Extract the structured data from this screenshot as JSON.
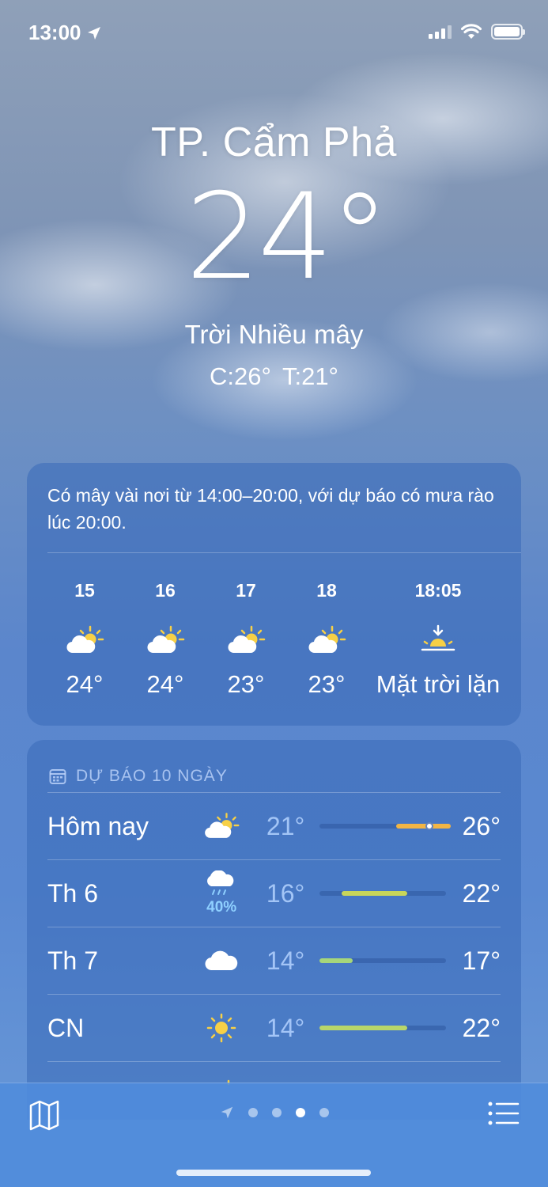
{
  "status_bar": {
    "time": "13:00",
    "location_icon": "location-arrow-icon",
    "signal_icon": "cellular-signal-icon",
    "wifi_icon": "wifi-icon",
    "battery_icon": "battery-icon"
  },
  "current": {
    "city": "TP. Cẩm Phả",
    "temperature": "24°",
    "condition": "Trời Nhiều mây",
    "high_low": "C:26°  T:21°"
  },
  "hourly": {
    "summary": "Có mây vài nơi từ 14:00–20:00, với dự báo có mưa rào lúc 20:00.",
    "hours": [
      {
        "label": "15",
        "icon": "partly-cloudy-day-icon",
        "temp": "24°"
      },
      {
        "label": "16",
        "icon": "partly-cloudy-day-icon",
        "temp": "24°"
      },
      {
        "label": "17",
        "icon": "partly-cloudy-day-icon",
        "temp": "23°"
      },
      {
        "label": "18",
        "icon": "partly-cloudy-day-icon",
        "temp": "23°"
      },
      {
        "label": "18:05",
        "icon": "sunset-icon",
        "temp": "Mặt trời lặn"
      }
    ]
  },
  "daily": {
    "title": "DỰ BÁO 10 NGÀY",
    "title_icon": "calendar-icon",
    "bar_range": [
      14,
      26
    ],
    "days": [
      {
        "name": "Hôm nay",
        "icon": "partly-cloudy-day-icon",
        "precip": "",
        "low": "21°",
        "high": "26°",
        "low_value": 21,
        "high_value": 26,
        "current_value": 24,
        "bar_color": "#f2b544"
      },
      {
        "name": "Th 6",
        "icon": "rain-cloud-icon",
        "precip": "40%",
        "low": "16°",
        "high": "22°",
        "low_value": 16,
        "high_value": 22,
        "bar_color": "#c8d65a"
      },
      {
        "name": "Th 7",
        "icon": "cloud-icon",
        "precip": "",
        "low": "14°",
        "high": "17°",
        "low_value": 14,
        "high_value": 17,
        "bar_color": "#a6d67a"
      },
      {
        "name": "CN",
        "icon": "sun-icon",
        "precip": "",
        "low": "14°",
        "high": "22°",
        "low_value": 14,
        "high_value": 22,
        "bar_color": "#b8d66a"
      }
    ]
  },
  "bottom_bar": {
    "map_icon": "map-icon",
    "list_icon": "list-icon",
    "pages": 4,
    "active_page": 2
  }
}
